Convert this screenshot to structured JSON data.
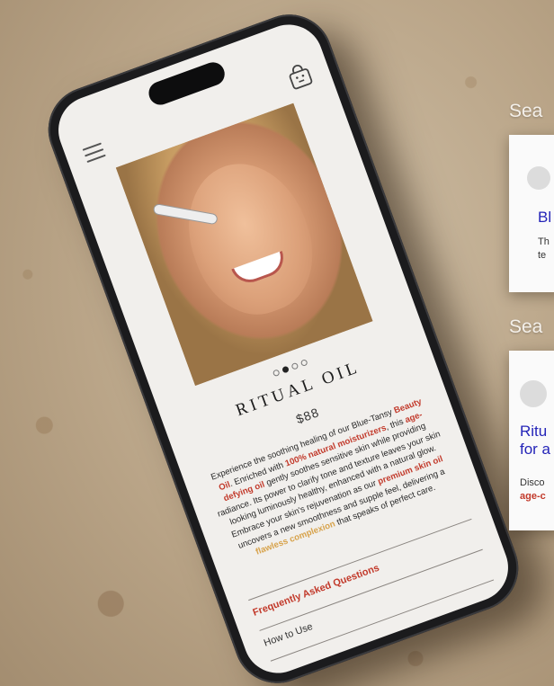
{
  "product": {
    "name": "RITUAL OIL",
    "price": "$88",
    "carousel_active": 2,
    "carousel_count": 4,
    "description_parts": [
      {
        "text": "Experience the soothing healing of our Blue-Tansy ",
        "style": "plain"
      },
      {
        "text": "Beauty Oil",
        "style": "red"
      },
      {
        "text": ". Enriched with ",
        "style": "plain"
      },
      {
        "text": "100% natural moisturizers",
        "style": "red"
      },
      {
        "text": ", this ",
        "style": "plain"
      },
      {
        "text": "age-defying oil",
        "style": "red"
      },
      {
        "text": " gently soothes sensitive skin while providing radiance. Its power to clarify tone and texture leaves your skin looking luminously healthy, enhanced with a natural glow. Embrace your skin's rejuvenation as our ",
        "style": "plain"
      },
      {
        "text": "premium skin oil",
        "style": "red"
      },
      {
        "text": " uncovers a new smoothness and supple feel, delivering a ",
        "style": "plain"
      },
      {
        "text": "flawless complexion",
        "style": "gold"
      },
      {
        "text": " that speaks of perfect care.",
        "style": "plain"
      }
    ]
  },
  "links": {
    "faq": "Frequently Asked Questions",
    "how_to_use": "How to Use"
  },
  "icons": {
    "menu": "hamburger-menu-icon",
    "cart": "shopping-bag-icon"
  },
  "serp": {
    "label_top": "Sea",
    "label_bottom": "Sea",
    "card1": {
      "title": "Bl",
      "snippet_line1": "Th",
      "snippet_line2": "te"
    },
    "card2": {
      "title_line1": "Ritu",
      "title_line2": "for a",
      "snippet_line1": "Disco",
      "snippet_line2": "age-c"
    }
  },
  "colors": {
    "keyword_red": "#c23a2b",
    "keyword_gold": "#d7a24a",
    "serp_link": "#2424b8"
  }
}
